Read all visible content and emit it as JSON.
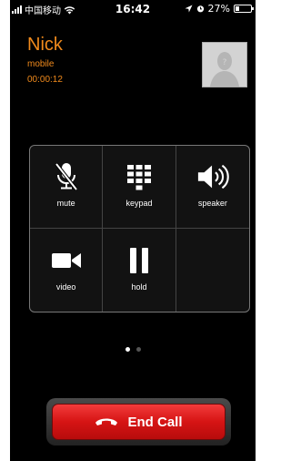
{
  "status_bar": {
    "carrier": "中国移动",
    "time": "16:42",
    "battery_percent": "27%",
    "battery_level": 0.27,
    "icons": [
      "signal-icon",
      "wifi-icon",
      "location-arrow-icon",
      "alarm-icon",
      "battery-icon"
    ]
  },
  "caller": {
    "name": "Nick",
    "type": "mobile",
    "duration": "00:00:12",
    "avatar_icon": "contact-placeholder-icon"
  },
  "controls": [
    {
      "label": "mute",
      "icon": "mute-mic-icon"
    },
    {
      "label": "keypad",
      "icon": "keypad-icon"
    },
    {
      "label": "speaker",
      "icon": "speaker-icon"
    },
    {
      "label": "video",
      "icon": "video-camera-icon"
    },
    {
      "label": "hold",
      "icon": "pause-icon"
    }
  ],
  "page_indicator": {
    "count": 2,
    "active": 0
  },
  "end_call": {
    "label": "End Call",
    "icon": "hang-up-phone-icon"
  },
  "colors": {
    "caller_text": "#f08a1c",
    "end_call_red": "#d61414",
    "background": "#000000"
  }
}
